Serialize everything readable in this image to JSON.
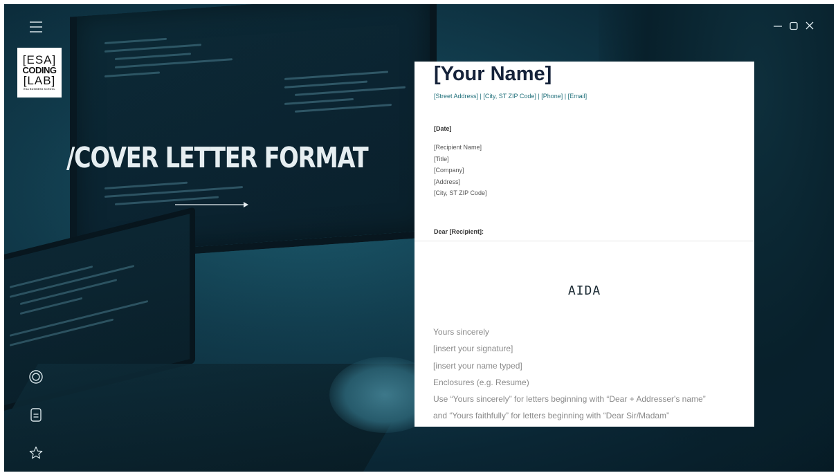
{
  "window": {
    "menu_icon": "hamburger-menu-icon",
    "minimize_icon": "minimize-icon",
    "maximize_icon": "maximize-icon",
    "close_icon": "close-icon"
  },
  "logo": {
    "line1": "[ESA]",
    "line2": "CODING",
    "line3": "[LAB]",
    "line4": "ESA BUSINESS SCHOOL"
  },
  "headline": "/COVER LETTER FORMAT",
  "sidebar": {
    "icons": [
      "target-icon",
      "document-icon",
      "star-icon"
    ]
  },
  "letter": {
    "name": "[Your Name]",
    "contact": "[Street Address] | [City, ST ZIP Code] | [Phone] | [Email]",
    "date": "[Date]",
    "recipient_lines": [
      "[Recipient Name]",
      "[Title]",
      "[Company]",
      "[Address]",
      "[City, ST ZIP Code]"
    ],
    "salutation": "Dear [Recipient]:",
    "body_label": "AIDA",
    "closing_lines": [
      "Yours sincerely",
      "[insert your signature]",
      "[insert your name typed]",
      "Enclosures (e.g. Resume)",
      "Use “Yours sincerely” for letters beginning with “Dear + Addresser's name”",
      "and “Yours faithfully” for letters beginning with “Dear Sir/Madam”"
    ]
  },
  "colors": {
    "background_teal": "#123e4f",
    "headline": "#e6eef1",
    "letter_name": "#15223a",
    "contact_link": "#1f6f7a"
  }
}
